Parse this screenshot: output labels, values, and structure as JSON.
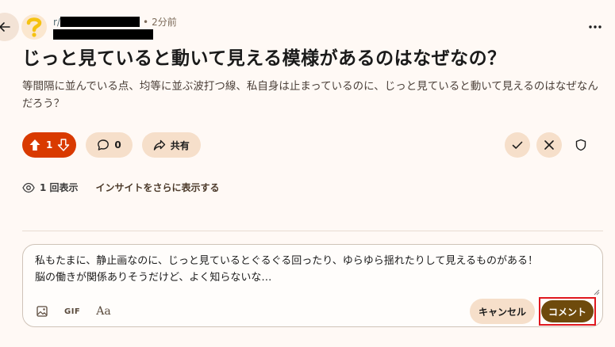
{
  "post": {
    "subreddit_prefix": "r/",
    "time_sep": "•",
    "time": "2分前",
    "title": "じっと見ていると動いて見える模様があるのはなぜなの？",
    "body": "等間隔に並んでいる点、均等に並ぶ波打つ線、私自身は止まっているのに、じっと見ていると動いて見えるのはなぜなんだろう？"
  },
  "actions": {
    "vote_count": "1",
    "comment_count": "0",
    "share_label": "共有"
  },
  "stats": {
    "views_label": "1 回表示",
    "insights_label": "インサイトをさらに表示する"
  },
  "composer": {
    "text": "私もたまに、静止画なのに、じっと見ているとぐるぐる回ったり、ゆらゆら揺れたりして見えるものがある！\n脳の働きが関係ありそうだけど、よく知らないな…",
    "gif_label": "GIF",
    "format_label": "Aa",
    "cancel_label": "キャンセル",
    "submit_label": "コメント"
  },
  "colors": {
    "background": "#fff9f5",
    "upvote_active": "#d93a00",
    "pill": "#f6dfca",
    "submit": "#6e4a0c",
    "highlight": "#e0181f"
  },
  "icons": {
    "back": "arrow-left-icon",
    "avatar": "question-mark-icon",
    "more": "ellipsis-icon",
    "upvote": "arrow-up-icon",
    "downvote": "arrow-down-icon",
    "comment": "speech-bubble-icon",
    "share": "share-arrow-icon",
    "approve": "checkmark-icon",
    "remove": "close-icon",
    "mod": "shield-icon",
    "views": "eye-icon",
    "image": "image-icon"
  }
}
